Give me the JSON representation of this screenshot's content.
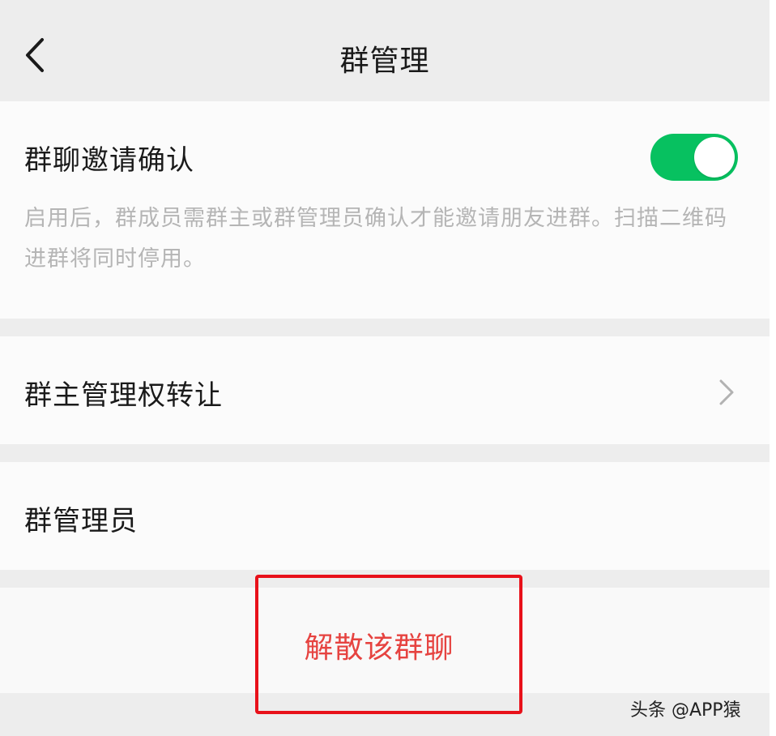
{
  "nav": {
    "title": "群管理",
    "back_icon": "chevron-left-icon"
  },
  "invite_confirm": {
    "title": "群聊邀请确认",
    "description": "启用后，群成员需群主或群管理员确认才能邀请朋友进群。扫描二维码进群将同时停用。",
    "toggle_on": true,
    "toggle_color": "#07c160"
  },
  "transfer_owner": {
    "title": "群主管理权转让",
    "chevron_icon": "chevron-right-icon"
  },
  "admins": {
    "title": "群管理员"
  },
  "dissolve": {
    "label": "解散该群聊",
    "color": "#e64340"
  },
  "watermark": "头条 @APP猿"
}
